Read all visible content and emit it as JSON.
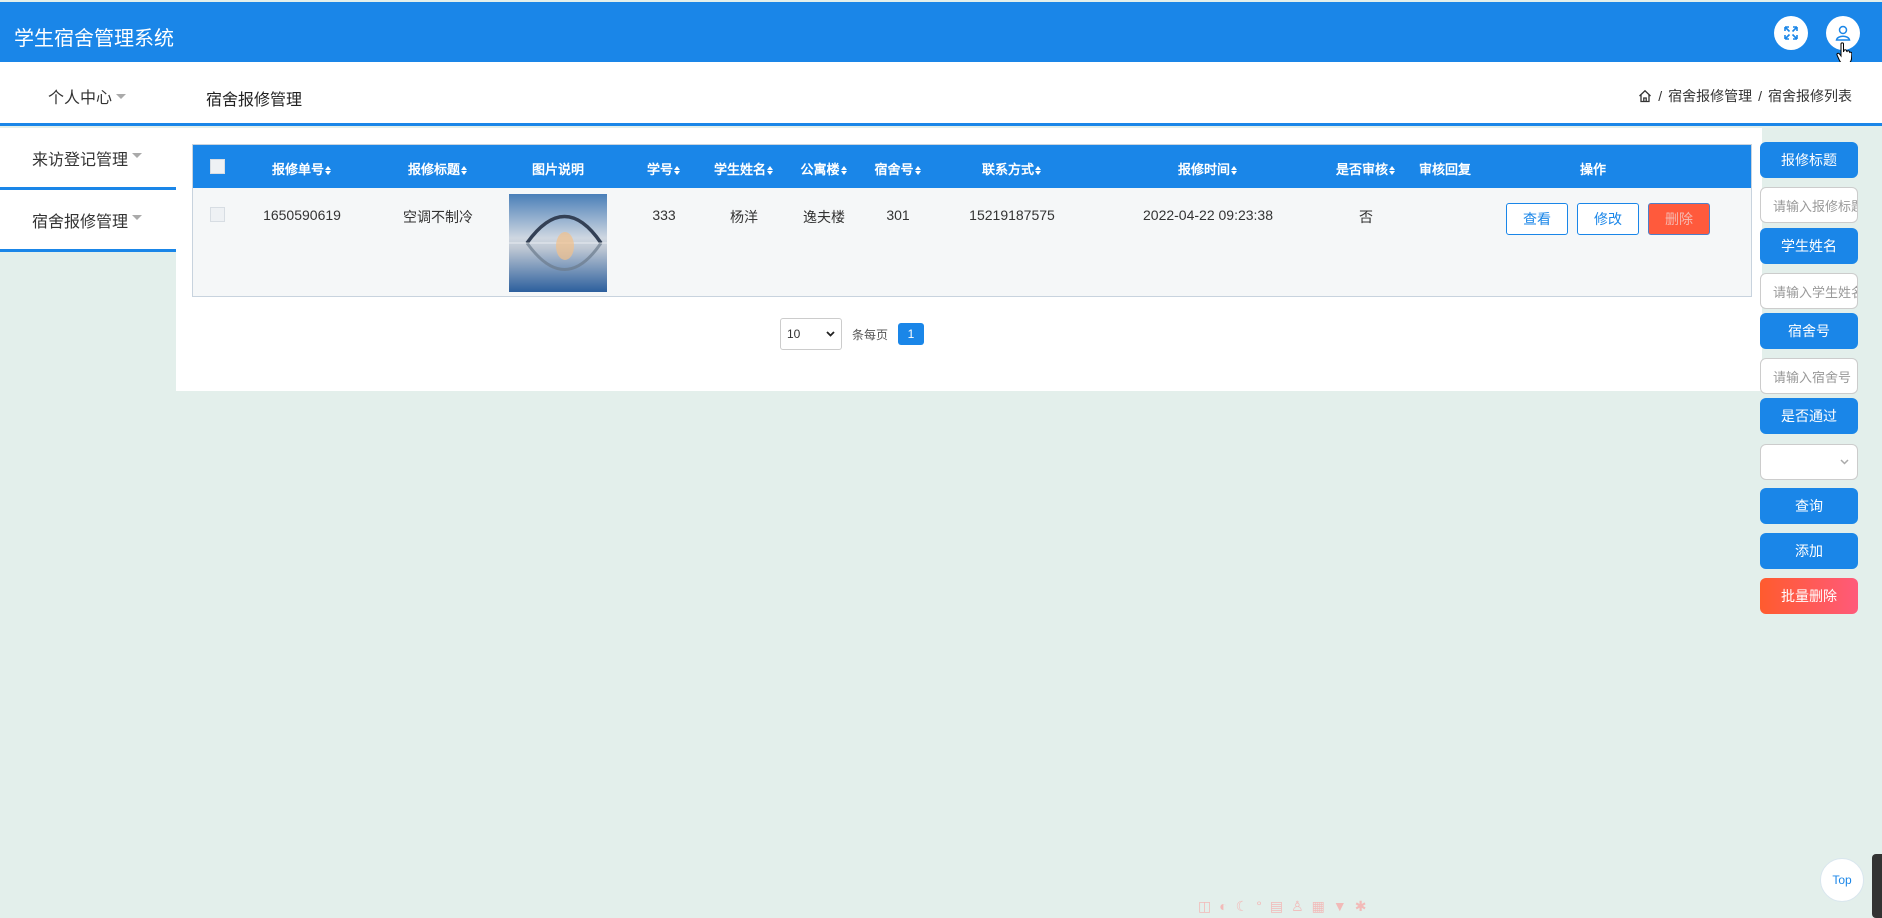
{
  "app": {
    "title": "学生宿舍管理系统"
  },
  "header": {
    "fullscreen_icon": "expand-icon",
    "user_icon": "user-icon"
  },
  "subheader": {
    "personal_menu": "个人中心",
    "page_heading": "宿舍报修管理",
    "breadcrumb": [
      "宿舍报修管理",
      "宿舍报修列表"
    ],
    "breadcrumb_sep": "/"
  },
  "sidebar": {
    "items": [
      {
        "label": "来访登记管理"
      },
      {
        "label": "宿舍报修管理"
      }
    ]
  },
  "table": {
    "headers": [
      "报修单号",
      "报修标题",
      "图片说明",
      "学号",
      "学生姓名",
      "公寓楼",
      "宿舍号",
      "联系方式",
      "报修时间",
      "是否审核",
      "审核回复",
      "操作"
    ],
    "rows": [
      {
        "id": "1650590619",
        "title": "空调不制冷",
        "student_no": "333",
        "student_name": "杨洋",
        "building": "逸夫楼",
        "room": "301",
        "phone": "15219187575",
        "time": "2022-04-22 09:23:38",
        "reviewed": "否",
        "reply": "",
        "actions": {
          "view": "查看",
          "edit": "修改",
          "delete": "删除"
        }
      }
    ]
  },
  "pagination": {
    "page_size": "10",
    "per_page_label": "条每页",
    "current_page": "1"
  },
  "filters": {
    "title_label": "报修标题",
    "title_placeholder": "请输入报修标题",
    "name_label": "学生姓名",
    "name_placeholder": "请输入学生姓名",
    "room_label": "宿舍号",
    "room_placeholder": "请输入宿舍号",
    "approved_label": "是否通过",
    "query_button": "查询",
    "add_button": "添加",
    "batch_delete_button": "批量删除"
  },
  "back_to_top": "Top",
  "colors": {
    "primary": "#1a86e8",
    "danger": "#ff5a3c",
    "background": "#e3efeb"
  }
}
